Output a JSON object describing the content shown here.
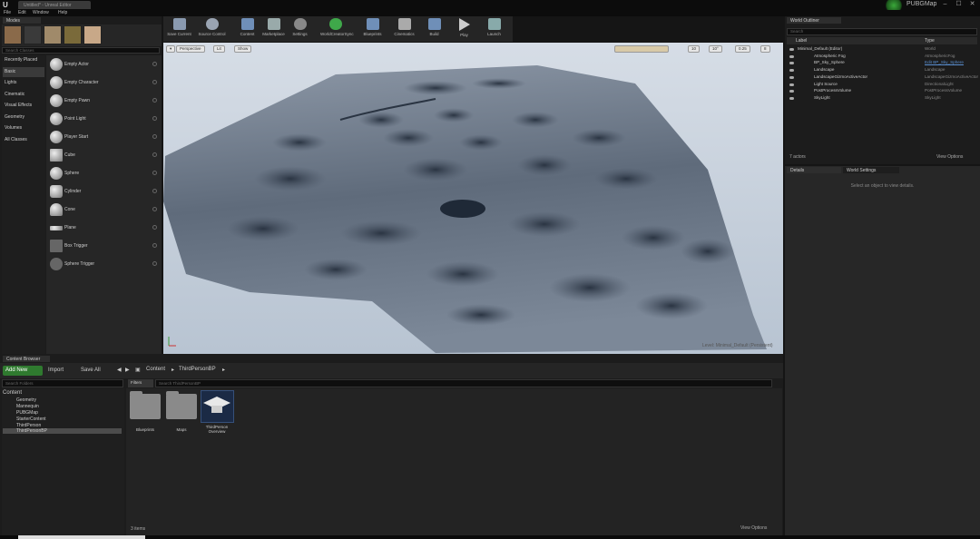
{
  "window": {
    "tab_title": "Untitled* - Unreal Editor",
    "logo": "U",
    "project": "PUBGMap",
    "min": "–",
    "max": "☐",
    "close": "✕"
  },
  "menu": [
    "File",
    "Edit",
    "Window",
    "Help"
  ],
  "modes": {
    "tab": "Modes",
    "search_placeholder": "Search Classes",
    "categories": [
      "Recently Placed",
      "Basic",
      "Lights",
      "Cinematic",
      "Visual Effects",
      "Geometry",
      "Volumes",
      "All Classes"
    ],
    "items": [
      "Empty Actor",
      "Empty Character",
      "Empty Pawn",
      "Point Light",
      "Player Start",
      "Cube",
      "Sphere",
      "Cylinder",
      "Cone",
      "Plane",
      "Box Trigger",
      "Sphere Trigger"
    ]
  },
  "toolbar": [
    "Save Current",
    "Source Control",
    "Content",
    "Marketplace",
    "Settings",
    "WorldCreatorSync",
    "Blueprints",
    "Cinematics",
    "Build",
    "Play",
    "Launch"
  ],
  "viewport": {
    "perspective": "Perspective",
    "lit": "Lit",
    "show": "Show",
    "grid": "10",
    "angle": "10°",
    "scale": "0.25",
    "cam": "8",
    "level": "Level: Minimal_Default (Persistent)"
  },
  "content_browser": {
    "tab": "Content Browser",
    "add_new": "Add New",
    "import": "Import",
    "save_all": "Save All",
    "breadcrumb": [
      "Content",
      "ThirdPersonBP"
    ],
    "search_folders": "Search Folders",
    "filters": "Filters",
    "search_assets": "Search ThirdPersonBP",
    "tree": [
      "Content",
      "Geometry",
      "Mannequin",
      "PUBGMap",
      "StarterContent",
      "ThirdPerson",
      "ThirdPersonBP"
    ],
    "assets": [
      "Blueprints",
      "Maps",
      "ThirdPerson Overview"
    ],
    "status": "3 items",
    "view_options": "View Options"
  },
  "outliner": {
    "tab": "World Outliner",
    "search": "Search",
    "col_label": "Label",
    "col_type": "Type",
    "rows": [
      {
        "name": "Minimal_Default (Editor)",
        "type": "World"
      },
      {
        "name": "Atmospheric Fog",
        "type": "AtmosphericFog"
      },
      {
        "name": "BP_Sky_Sphere",
        "type": "Edit BP_Sky_Sphere"
      },
      {
        "name": "Landscape",
        "type": "Landscape"
      },
      {
        "name": "LandscapeGizmoActiveActor",
        "type": "LandscapeGizmoActiveActor"
      },
      {
        "name": "Light Source",
        "type": "DirectionalLight"
      },
      {
        "name": "PostProcessVolume",
        "type": "PostProcessVolume"
      },
      {
        "name": "SkyLight",
        "type": "SkyLight"
      }
    ],
    "status": "7 actors",
    "view_options": "View Options"
  },
  "details": {
    "tab": "Details",
    "world_settings": "World Settings",
    "message": "Select an object to view details."
  },
  "colors": {
    "accent_green": "#2f7a2f",
    "selection": "#4c4c4c",
    "link": "#5a8fd0"
  }
}
